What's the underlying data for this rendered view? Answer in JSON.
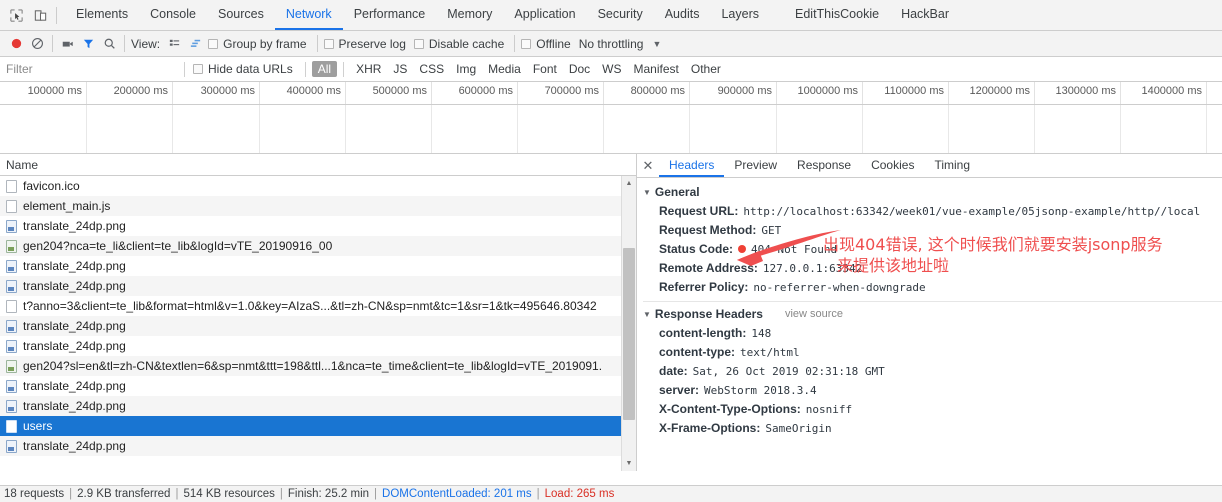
{
  "devtools": {
    "toolbar_icons": [
      "inspect-element-icon",
      "device-toolbar-icon"
    ],
    "tabs": [
      {
        "label": "Elements",
        "selected": false
      },
      {
        "label": "Console",
        "selected": false
      },
      {
        "label": "Sources",
        "selected": false
      },
      {
        "label": "Network",
        "selected": true
      },
      {
        "label": "Performance",
        "selected": false
      },
      {
        "label": "Memory",
        "selected": false
      },
      {
        "label": "Application",
        "selected": false
      },
      {
        "label": "Security",
        "selected": false
      },
      {
        "label": "Audits",
        "selected": false
      },
      {
        "label": "Layers",
        "selected": false
      },
      {
        "label": "EditThisCookie",
        "selected": false
      },
      {
        "label": "HackBar",
        "selected": false
      }
    ]
  },
  "controlbar": {
    "record_icon": "record-icon",
    "clear_icon": "clear-icon",
    "screenshot_icon": "camera-icon",
    "filter_icon": "filter-funnel-icon",
    "search_icon": "search-icon",
    "view_label": "View:",
    "view_list_icon": "list-view-icon",
    "view_waterfall_icon": "waterfall-view-icon",
    "group_by_frame": "Group by frame",
    "preserve_log": "Preserve log",
    "disable_cache": "Disable cache",
    "offline": "Offline",
    "throttling": "No throttling",
    "throttle_caret": "chevron-down-icon"
  },
  "filterbar": {
    "filter_placeholder": "Filter",
    "filter_value": "",
    "hide_data_urls": "Hide data URLs",
    "types": [
      {
        "label": "All",
        "selected": true
      },
      {
        "label": "XHR",
        "selected": false
      },
      {
        "label": "JS",
        "selected": false
      },
      {
        "label": "CSS",
        "selected": false
      },
      {
        "label": "Img",
        "selected": false
      },
      {
        "label": "Media",
        "selected": false
      },
      {
        "label": "Font",
        "selected": false
      },
      {
        "label": "Doc",
        "selected": false
      },
      {
        "label": "WS",
        "selected": false
      },
      {
        "label": "Manifest",
        "selected": false
      },
      {
        "label": "Other",
        "selected": false
      }
    ]
  },
  "timeline": {
    "ticks": [
      "100000 ms",
      "200000 ms",
      "300000 ms",
      "400000 ms",
      "500000 ms",
      "600000 ms",
      "700000 ms",
      "800000 ms",
      "900000 ms",
      "1000000 ms",
      "1100000 ms",
      "1200000 ms",
      "1300000 ms",
      "1400000 ms"
    ]
  },
  "requests": {
    "column_header": "Name",
    "rows": [
      {
        "name": "favicon.ico",
        "icon": "plain-file-icon",
        "selected": false
      },
      {
        "name": "element_main.js",
        "icon": "plain-file-icon",
        "selected": false
      },
      {
        "name": "translate_24dp.png",
        "icon": "image-file-icon",
        "selected": false
      },
      {
        "name": "gen204?nca=te_li&client=te_lib&logId=vTE_20190916_00",
        "icon": "document-file-icon",
        "selected": false
      },
      {
        "name": "translate_24dp.png",
        "icon": "image-file-icon",
        "selected": false
      },
      {
        "name": "translate_24dp.png",
        "icon": "image-file-icon",
        "selected": false
      },
      {
        "name": "t?anno=3&client=te_lib&format=html&v=1.0&key=AIzaS...&tl=zh-CN&sp=nmt&tc=1&sr=1&tk=495646.80342",
        "icon": "plain-file-icon",
        "selected": false
      },
      {
        "name": "translate_24dp.png",
        "icon": "image-file-icon",
        "selected": false
      },
      {
        "name": "translate_24dp.png",
        "icon": "image-file-icon",
        "selected": false
      },
      {
        "name": "gen204?sl=en&tl=zh-CN&textlen=6&sp=nmt&ttt=198&ttl...1&nca=te_time&client=te_lib&logId=vTE_2019091.",
        "icon": "document-file-icon",
        "selected": false
      },
      {
        "name": "translate_24dp.png",
        "icon": "image-file-icon",
        "selected": false
      },
      {
        "name": "translate_24dp.png",
        "icon": "image-file-icon",
        "selected": false
      },
      {
        "name": "users",
        "icon": "plain-file-icon",
        "selected": true
      },
      {
        "name": "translate_24dp.png",
        "icon": "image-file-icon",
        "selected": false
      }
    ]
  },
  "details": {
    "close_icon": "close-icon",
    "tabs": [
      {
        "label": "Headers",
        "selected": true
      },
      {
        "label": "Preview",
        "selected": false
      },
      {
        "label": "Response",
        "selected": false
      },
      {
        "label": "Cookies",
        "selected": false
      },
      {
        "label": "Timing",
        "selected": false
      }
    ],
    "general": {
      "title": "General",
      "rows": [
        {
          "key": "Request URL:",
          "value": "http://localhost:63342/week01/vue-example/05jsonp-example/http//local"
        },
        {
          "key": "Request Method:",
          "value": "GET"
        },
        {
          "key": "Status Code:",
          "value": "404 Not Found",
          "has_status_dot": true
        },
        {
          "key": "Remote Address:",
          "value": "127.0.0.1:63342"
        },
        {
          "key": "Referrer Policy:",
          "value": "no-referrer-when-downgrade"
        }
      ]
    },
    "response_headers": {
      "title": "Response Headers",
      "view_source": "view source",
      "rows": [
        {
          "key": "content-length:",
          "value": "148"
        },
        {
          "key": "content-type:",
          "value": "text/html"
        },
        {
          "key": "date:",
          "value": "Sat, 26 Oct 2019 02:31:18 GMT"
        },
        {
          "key": "server:",
          "value": "WebStorm 2018.3.4"
        },
        {
          "key": "X-Content-Type-Options:",
          "value": "nosniff"
        },
        {
          "key": "X-Frame-Options:",
          "value": "SameOrigin"
        }
      ]
    }
  },
  "annotation": {
    "line1": "出现404错误, 这个时候我们就要安装jsonp服务",
    "line2": "来提供该地址啦",
    "color": "#ef4f4f",
    "arrow_icon": "red-arrow-icon"
  },
  "statusbar": {
    "requests": "18 requests",
    "transferred": "2.9 KB transferred",
    "resources": "514 KB resources",
    "finish": "Finish: 25.2 min",
    "domcontentloaded": "DOMContentLoaded: 201 ms",
    "load": "Load: 265 ms",
    "separator": "|"
  }
}
